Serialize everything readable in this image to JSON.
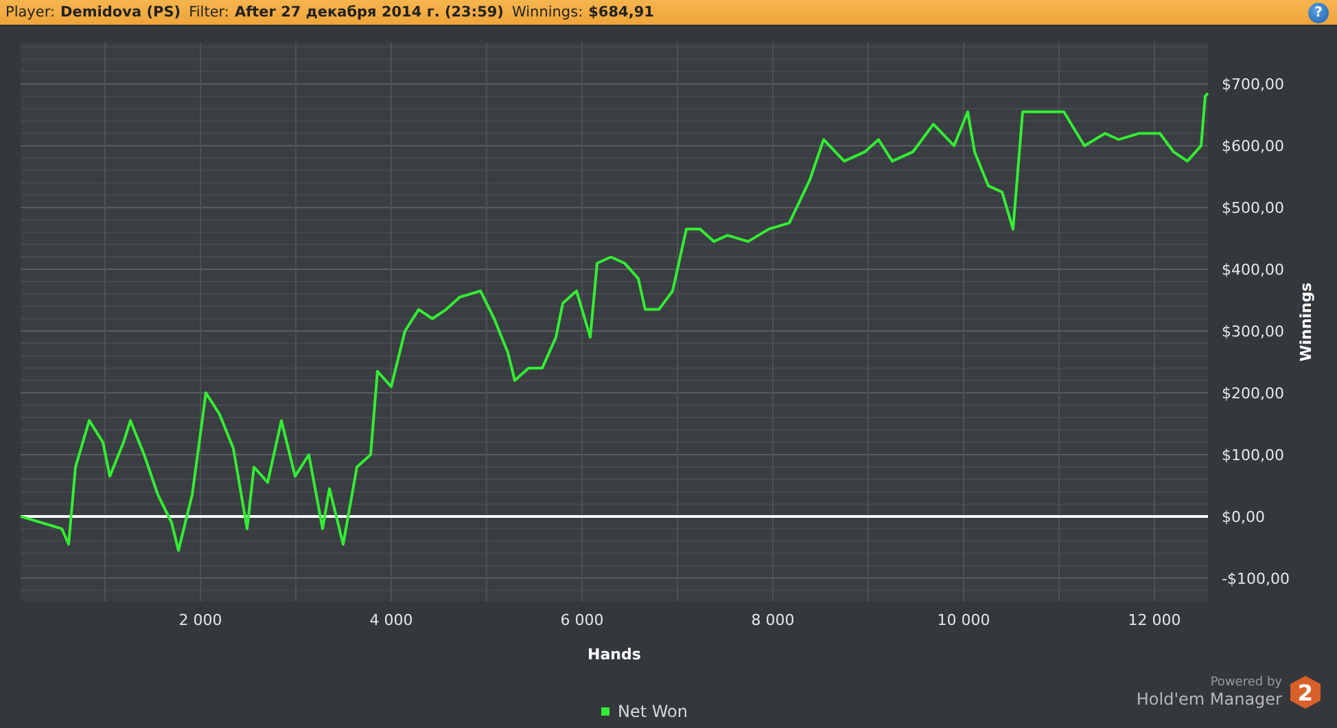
{
  "header": {
    "player_label": "Player:",
    "player": "Demidova (PS)",
    "filter_label": "Filter:",
    "filter": "After 27 декабря 2014 г. (23:59)",
    "winnings_label": "Winnings:",
    "winnings": "$684,91",
    "help": "?"
  },
  "chart": {
    "chart_data": {
      "type": "line",
      "grid": true,
      "xlabel": "Hands",
      "ylabel": "Winnings",
      "xlim": [
        115,
        12561
      ],
      "ylim": [
        -138,
        767
      ],
      "xticks": [
        {
          "value": 2000,
          "label": "2 000"
        },
        {
          "value": 4000,
          "label": "4 000"
        },
        {
          "value": 6000,
          "label": "6 000"
        },
        {
          "value": 8000,
          "label": "8 000"
        },
        {
          "value": 10000,
          "label": "10 000"
        },
        {
          "value": 12000,
          "label": "12 000"
        }
      ],
      "yticks": [
        {
          "value": -100,
          "label": "-$100,00"
        },
        {
          "value": 0,
          "label": "$0,00"
        },
        {
          "value": 100,
          "label": "$100,00"
        },
        {
          "value": 200,
          "label": "$200,00"
        },
        {
          "value": 300,
          "label": "$300,00"
        },
        {
          "value": 400,
          "label": "$400,00"
        },
        {
          "value": 500,
          "label": "$500,00"
        },
        {
          "value": 600,
          "label": "$600,00"
        },
        {
          "value": 700,
          "label": "$700,00"
        }
      ],
      "x": [
        115,
        331,
        547,
        619,
        691,
        835,
        978,
        1050,
        1194,
        1266,
        1410,
        1554,
        1698,
        1770,
        1914,
        2058,
        2201,
        2345,
        2489,
        2561,
        2705,
        2849,
        2993,
        3137,
        3281,
        3353,
        3496,
        3640,
        3784,
        3856,
        4000,
        4144,
        4288,
        4432,
        4576,
        4719,
        4935,
        5079,
        5223,
        5295,
        5439,
        5583,
        5727,
        5799,
        5942,
        6086,
        6158,
        6302,
        6446,
        6590,
        6662,
        6806,
        6950,
        7094,
        7237,
        7381,
        7525,
        7741,
        7957,
        8173,
        8388,
        8532,
        8748,
        8964,
        9108,
        9252,
        9468,
        9683,
        9899,
        10043,
        10115,
        10259,
        10403,
        10518,
        10619,
        10835,
        11050,
        11266,
        11482,
        11626,
        11842,
        12058,
        12201,
        12345,
        12489,
        12532,
        12561
      ],
      "series": [
        {
          "name": "Net Won",
          "color": "#33ee33",
          "values": [
            0,
            -10,
            -20,
            -45,
            80,
            155,
            120,
            65,
            120,
            155,
            100,
            35,
            -10,
            -55,
            35,
            200,
            165,
            110,
            -20,
            80,
            55,
            155,
            65,
            100,
            -20,
            45,
            -45,
            80,
            100,
            235,
            210,
            300,
            335,
            320,
            335,
            355,
            365,
            320,
            265,
            220,
            240,
            240,
            290,
            345,
            365,
            290,
            410,
            420,
            410,
            385,
            335,
            335,
            365,
            465,
            465,
            445,
            455,
            445,
            465,
            475,
            545,
            610,
            575,
            590,
            610,
            575,
            590,
            635,
            600,
            655,
            590,
            535,
            525,
            465,
            655,
            655,
            655,
            600,
            620,
            610,
            620,
            620,
            590,
            575,
            600,
            680,
            685
          ]
        }
      ]
    }
  },
  "branding": {
    "powered_by": "Powered by",
    "product": "Hold'em Manager",
    "badge": "2"
  }
}
